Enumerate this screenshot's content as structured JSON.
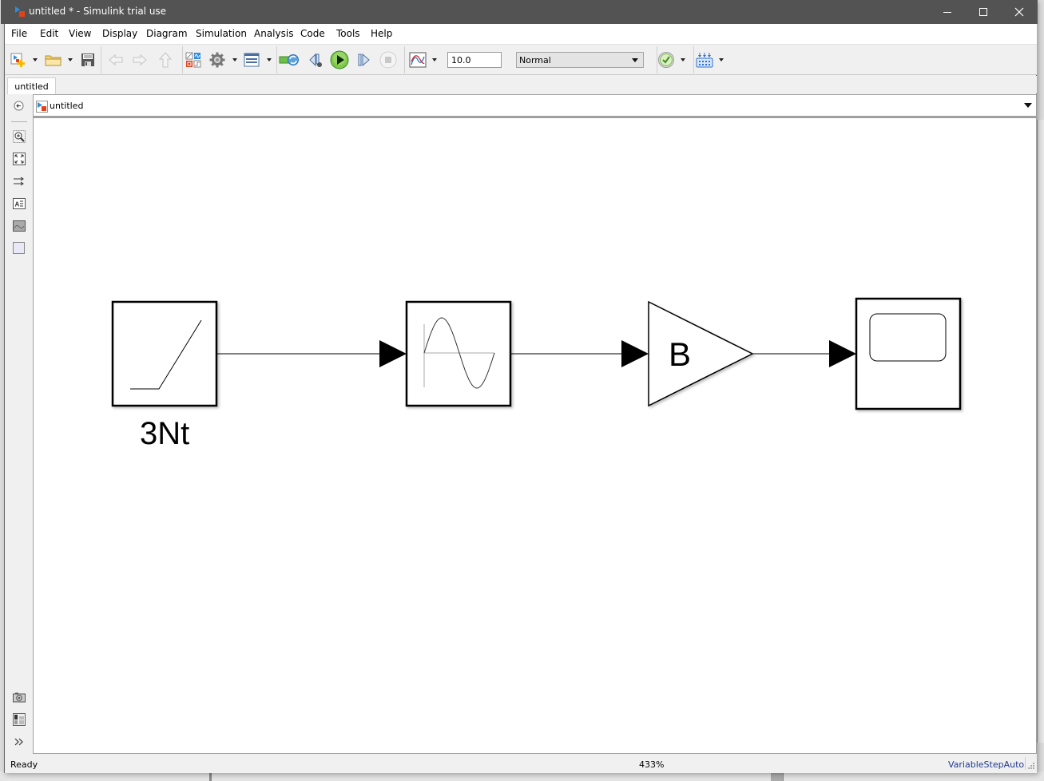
{
  "window": {
    "title": "untitled * - Simulink trial use",
    "controls": {
      "minimize": "minimize",
      "maximize": "maximize",
      "close": "close"
    }
  },
  "menu": [
    "File",
    "Edit",
    "View",
    "Display",
    "Diagram",
    "Simulation",
    "Analysis",
    "Code",
    "Tools",
    "Help"
  ],
  "toolbar": {
    "stop_time": "10.0",
    "simulation_mode": "Normal",
    "icons": [
      "new-model-icon",
      "open-folder-icon",
      "save-icon",
      "back-arrow-icon",
      "forward-arrow-icon",
      "up-arrow-icon",
      "library-browser-icon",
      "model-settings-gear-icon",
      "model-explorer-icon",
      "update-diagram-icon",
      "step-back-icon",
      "run-icon",
      "step-forward-icon",
      "stop-icon",
      "data-inspector-icon",
      "model-advisor-check-icon",
      "build-icon"
    ]
  },
  "tabs": [
    {
      "label": "untitled",
      "active": true
    }
  ],
  "address": {
    "path": "untitled"
  },
  "palette": [
    "hide-browser-icon",
    "zoom-icon",
    "fit-to-view-icon",
    "signal-routing-icon",
    "annotation-icon",
    "image-icon",
    "area-icon",
    "screenshot-camera-icon",
    "property-inspector-icon",
    "expand-icon"
  ],
  "diagram": {
    "blocks": [
      {
        "type": "Ramp",
        "label": "3Nt"
      },
      {
        "type": "Sine Function",
        "label": ""
      },
      {
        "type": "Gain",
        "label": "B"
      },
      {
        "type": "Scope",
        "label": ""
      }
    ],
    "connections": [
      [
        "Ramp",
        "Sine Function"
      ],
      [
        "Sine Function",
        "Gain"
      ],
      [
        "Gain",
        "Scope"
      ]
    ]
  },
  "status": {
    "state": "Ready",
    "zoom": "433%",
    "solver": "VariableStepAuto"
  }
}
